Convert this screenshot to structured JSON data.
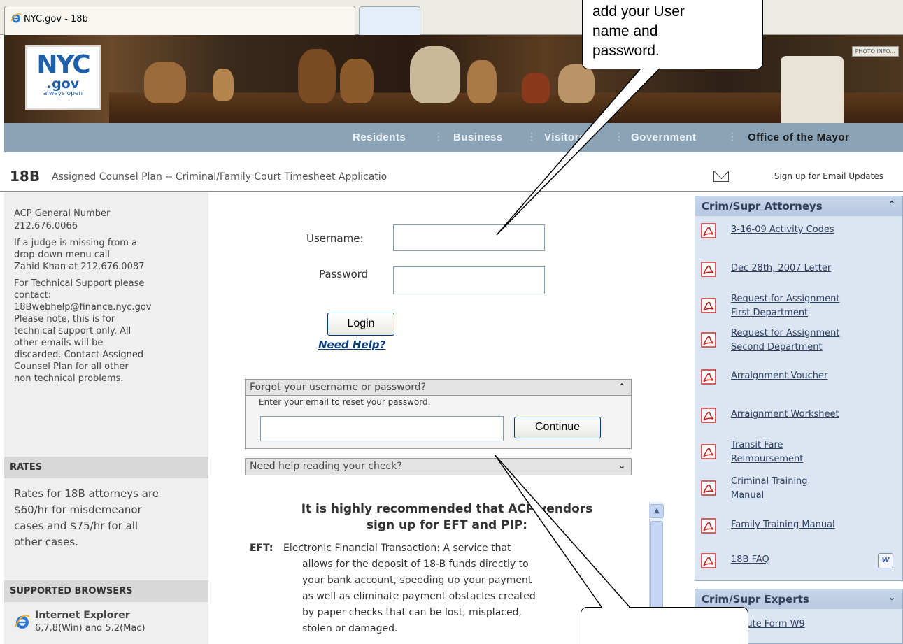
{
  "browser": {
    "tab_title": "NYC.gov - 18b"
  },
  "header": {
    "logo_nyc": "NYC",
    "logo_gov": ".gov",
    "logo_tagline": "always open",
    "photo_info": "PHOTO INFO...",
    "nav": [
      "Residents",
      "Business",
      "Visitors",
      "Government",
      "Office of the Mayor"
    ]
  },
  "title": {
    "code": "18B",
    "text": "Assigned Counsel Plan -- Criminal/Family Court Timesheet Applicatio",
    "email_signup": "Sign up for Email Updates"
  },
  "left": {
    "acp_label": "ACP General Number",
    "acp_number": "212.676.0066",
    "judge_lines": [
      "If a judge is missing from a",
      "drop-down menu call",
      "Zahid Khan at 212.676.0087"
    ],
    "support_lines": [
      "For Technical Support please",
      "contact:",
      "18Bwebhelp@finance.nyc.gov",
      "Please note, this is for",
      "technical support only. All",
      "other emails will be",
      "discarded. Contact Assigned",
      "Counsel Plan for all other",
      "non technical problems."
    ],
    "rates_heading": "RATES",
    "rates_lines": [
      "Rates for 18B attorneys are",
      "$60/hr for misdemeanor",
      "cases and $75/hr for all",
      "other cases."
    ],
    "browsers_heading": "SUPPORTED BROWSERS",
    "browser_name": "Internet Explorer",
    "browser_versions": "6,7,8(Win) and 5.2(Mac)"
  },
  "login": {
    "username_label": "Username:",
    "password_label": "Password",
    "login_button": "Login",
    "need_help": "Need Help?",
    "forgot_header": "Forgot your username or password?",
    "forgot_hint": "Enter your email to reset your password.",
    "continue_button": "Continue",
    "check_header": "Need help reading your check?"
  },
  "recommend": {
    "line1": "It is highly recommended that ACP vendors",
    "line2": "sign up for EFT and PIP:",
    "eft_label": "EFT:",
    "eft_lines": [
      "Electronic Financial Transaction: A service that",
      "allows for the deposit of 18-B funds directly to",
      "your bank account, speeding up your payment",
      "as well as eliminate payment obstacles created",
      "by paper checks that can be lost, misplaced,",
      "stolen or damaged."
    ]
  },
  "attorneys": {
    "heading": "Crim/Supr Attorneys",
    "items": [
      [
        "3-16-09 Activity Codes"
      ],
      [
        "Dec 28th, 2007 Letter"
      ],
      [
        "Request for Assignment",
        "First Department"
      ],
      [
        "Request for Assignment",
        "Second Department"
      ],
      [
        "Arraignment Voucher"
      ],
      [
        "Arraignment Worksheet"
      ],
      [
        "Transit Fare",
        "Reimbursement"
      ],
      [
        "Criminal Training",
        "Manual"
      ],
      [
        "Family Training Manual"
      ],
      [
        "18B FAQ"
      ]
    ]
  },
  "experts": {
    "heading": "Crim/Supr Experts",
    "items": [
      [
        "Substitute Form W9"
      ]
    ]
  },
  "callouts": {
    "top_lines": [
      "add your User",
      "name and",
      "password."
    ]
  }
}
